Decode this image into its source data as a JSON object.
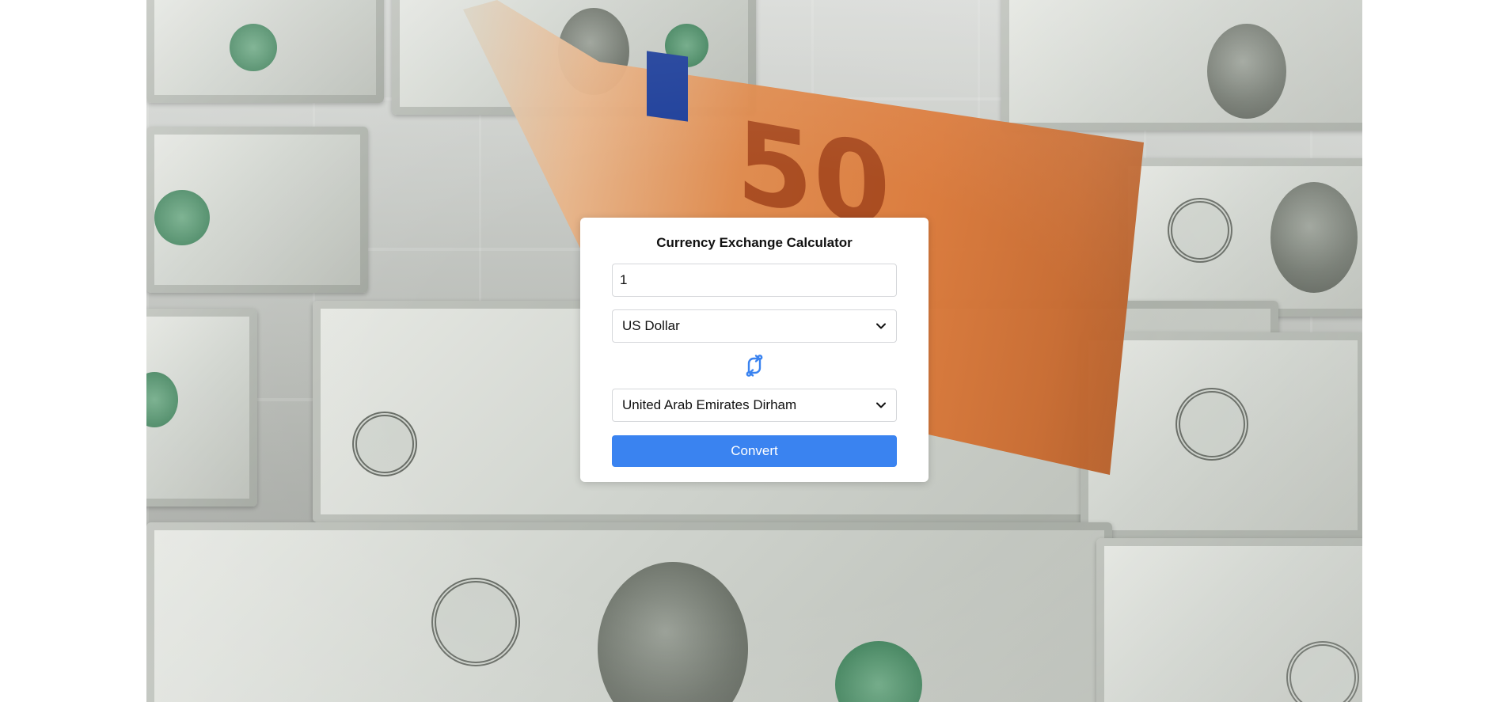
{
  "calculator": {
    "title": "Currency Exchange Calculator",
    "amount_value": "1",
    "from_currency": "US Dollar",
    "to_currency": "United Arab Emirates Dirham",
    "convert_label": "Convert",
    "swap_icon": "swap-arrows-icon",
    "accent_color": "#3a83f0"
  }
}
